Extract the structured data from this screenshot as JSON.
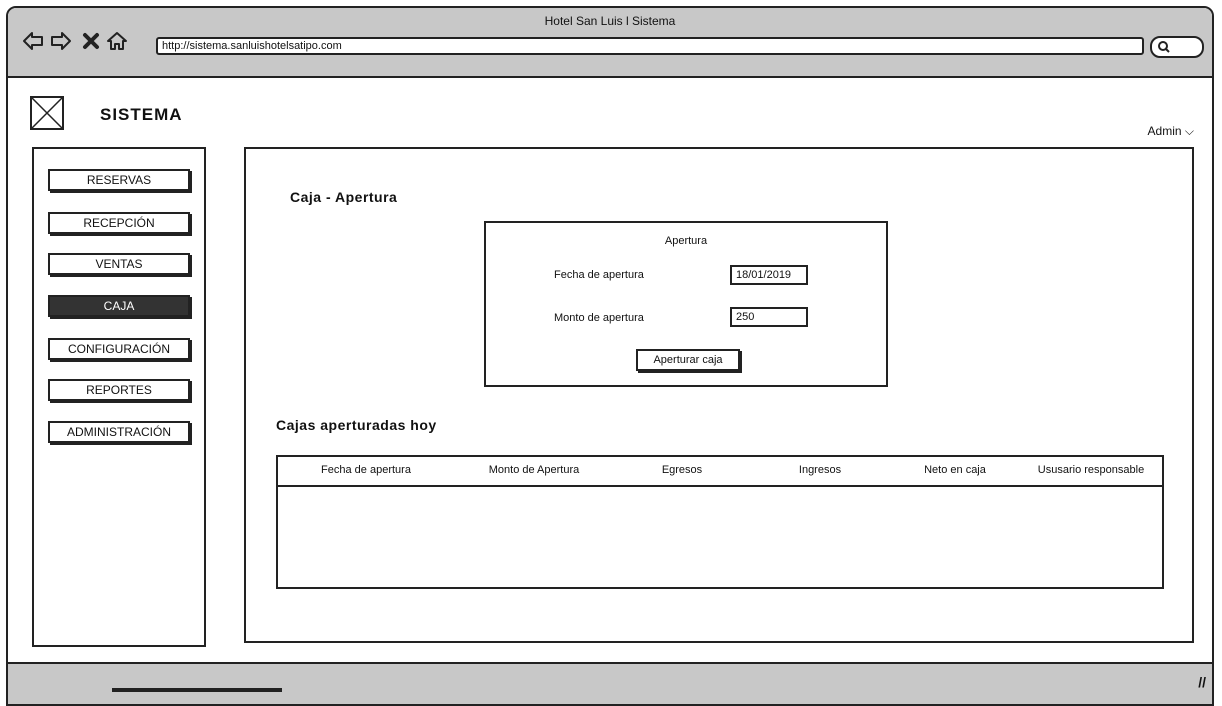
{
  "browser": {
    "title": "Hotel San Luis l Sistema",
    "url": "http://sistema.sanluishotelsatipo.com"
  },
  "header": {
    "brand": "SISTEMA",
    "user_menu": "Admin ⌵"
  },
  "sidebar": {
    "items": [
      {
        "label": "RESERVAS"
      },
      {
        "label": "RECEPCIÓN"
      },
      {
        "label": "VENTAS"
      },
      {
        "label": "CAJA",
        "active": true
      },
      {
        "label": "CONFIGURACIÓN"
      },
      {
        "label": "REPORTES"
      },
      {
        "label": "ADMINISTRACIÓN"
      }
    ]
  },
  "main": {
    "title": "Caja - Apertura",
    "form": {
      "title": "Apertura",
      "fecha_label": "Fecha de apertura",
      "fecha_value": "18/01/2019",
      "monto_label": "Monto de apertura",
      "monto_value": "250",
      "submit_label": "Aperturar caja"
    },
    "table_title": "Cajas aperturadas  hoy",
    "table": {
      "columns": [
        "Fecha  de apertura",
        "Monto de Apertura",
        "Egresos",
        "Ingresos",
        "Neto en caja",
        "Ususario responsable"
      ],
      "rows": []
    }
  },
  "icons": {
    "back": "back-arrow-icon",
    "forward": "forward-arrow-icon",
    "close": "close-x-icon",
    "home": "home-icon",
    "search": "search-icon",
    "logo": "image-placeholder-icon",
    "resize": "resize-grip-icon"
  }
}
